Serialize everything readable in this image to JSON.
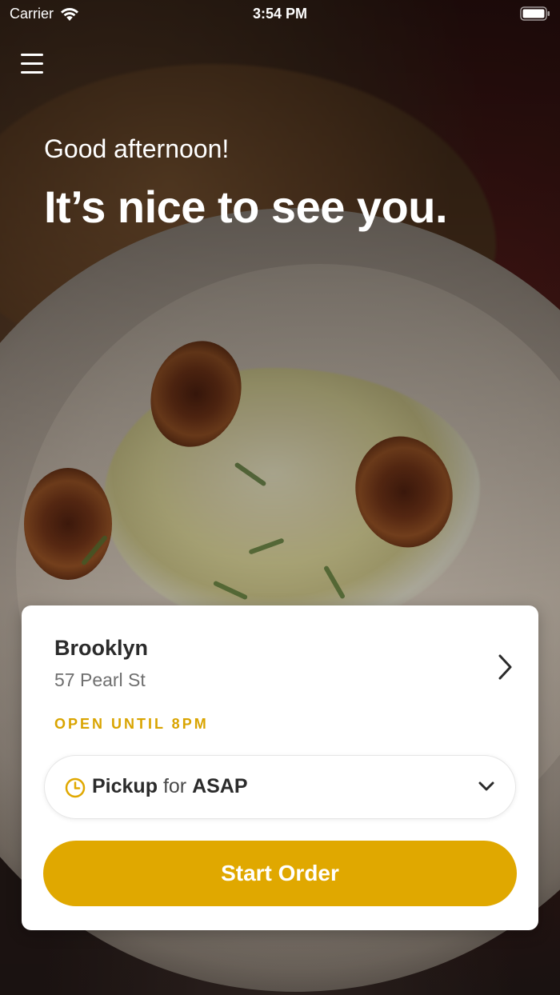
{
  "status_bar": {
    "carrier": "Carrier",
    "time": "3:54 PM",
    "icons": [
      "wifi-icon",
      "battery-icon"
    ]
  },
  "header": {
    "menu_icon": "hamburger-menu-icon",
    "greeting": "Good afternoon!",
    "headline": "It’s nice to see you."
  },
  "location_card": {
    "name": "Brooklyn",
    "address": "57 Pearl St",
    "hours": "OPEN UNTIL 8PM",
    "pickup": {
      "mode": "Pickup",
      "connector": "for",
      "time": "ASAP",
      "icon": "clock-icon",
      "dropdown_icon": "chevron-down-icon"
    },
    "start_order_label": "Start Order"
  },
  "colors": {
    "accent": "#e0a800",
    "hours_text": "#d9a400",
    "card_background": "#ffffff"
  }
}
